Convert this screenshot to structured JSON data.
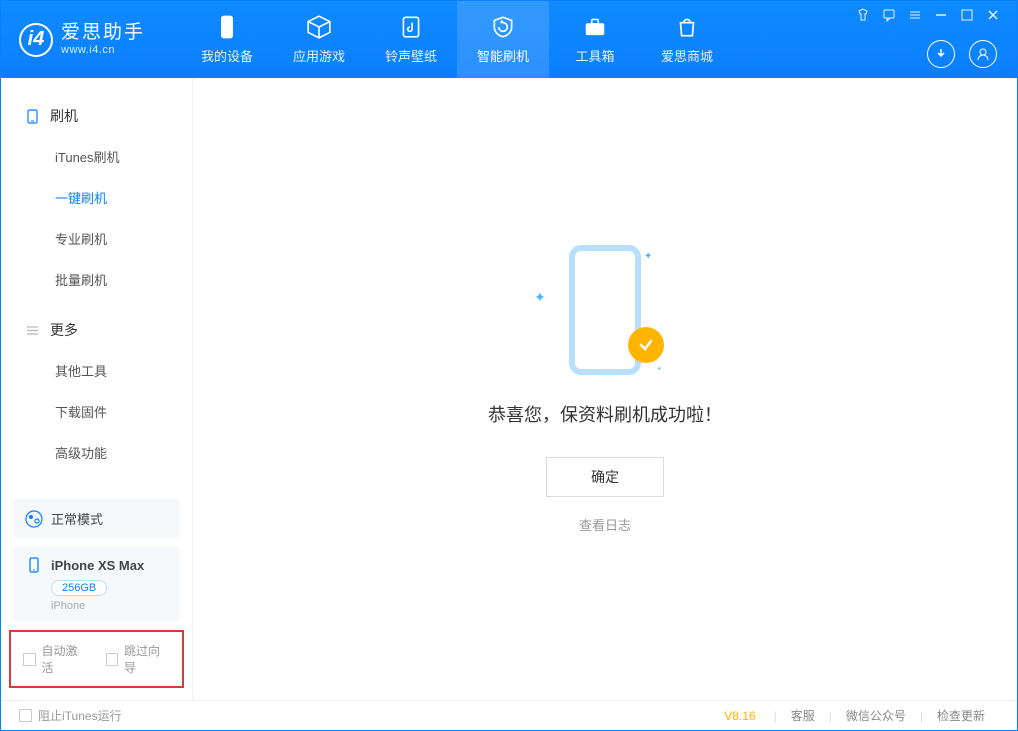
{
  "app": {
    "title": "爱思助手",
    "subtitle": "www.i4.cn"
  },
  "nav": {
    "my_device": "我的设备",
    "apps_games": "应用游戏",
    "ringtones": "铃声壁纸",
    "smart_flash": "智能刷机",
    "toolbox": "工具箱",
    "store": "爱思商城"
  },
  "sidebar": {
    "group_flash": "刷机",
    "items_flash": [
      "iTunes刷机",
      "一键刷机",
      "专业刷机",
      "批量刷机"
    ],
    "group_more": "更多",
    "items_more": [
      "其他工具",
      "下载固件",
      "高级功能"
    ]
  },
  "mode_panel": {
    "label": "正常模式"
  },
  "device_panel": {
    "name": "iPhone XS Max",
    "storage": "256GB",
    "type": "iPhone"
  },
  "options": {
    "auto_activate": "自动激活",
    "skip_guide": "跳过向导"
  },
  "main": {
    "success_msg": "恭喜您，保资料刷机成功啦！",
    "ok_btn": "确定",
    "view_log": "查看日志"
  },
  "footer": {
    "block_itunes": "阻止iTunes运行",
    "version": "V8.16",
    "links": [
      "客服",
      "微信公众号",
      "检查更新"
    ]
  }
}
